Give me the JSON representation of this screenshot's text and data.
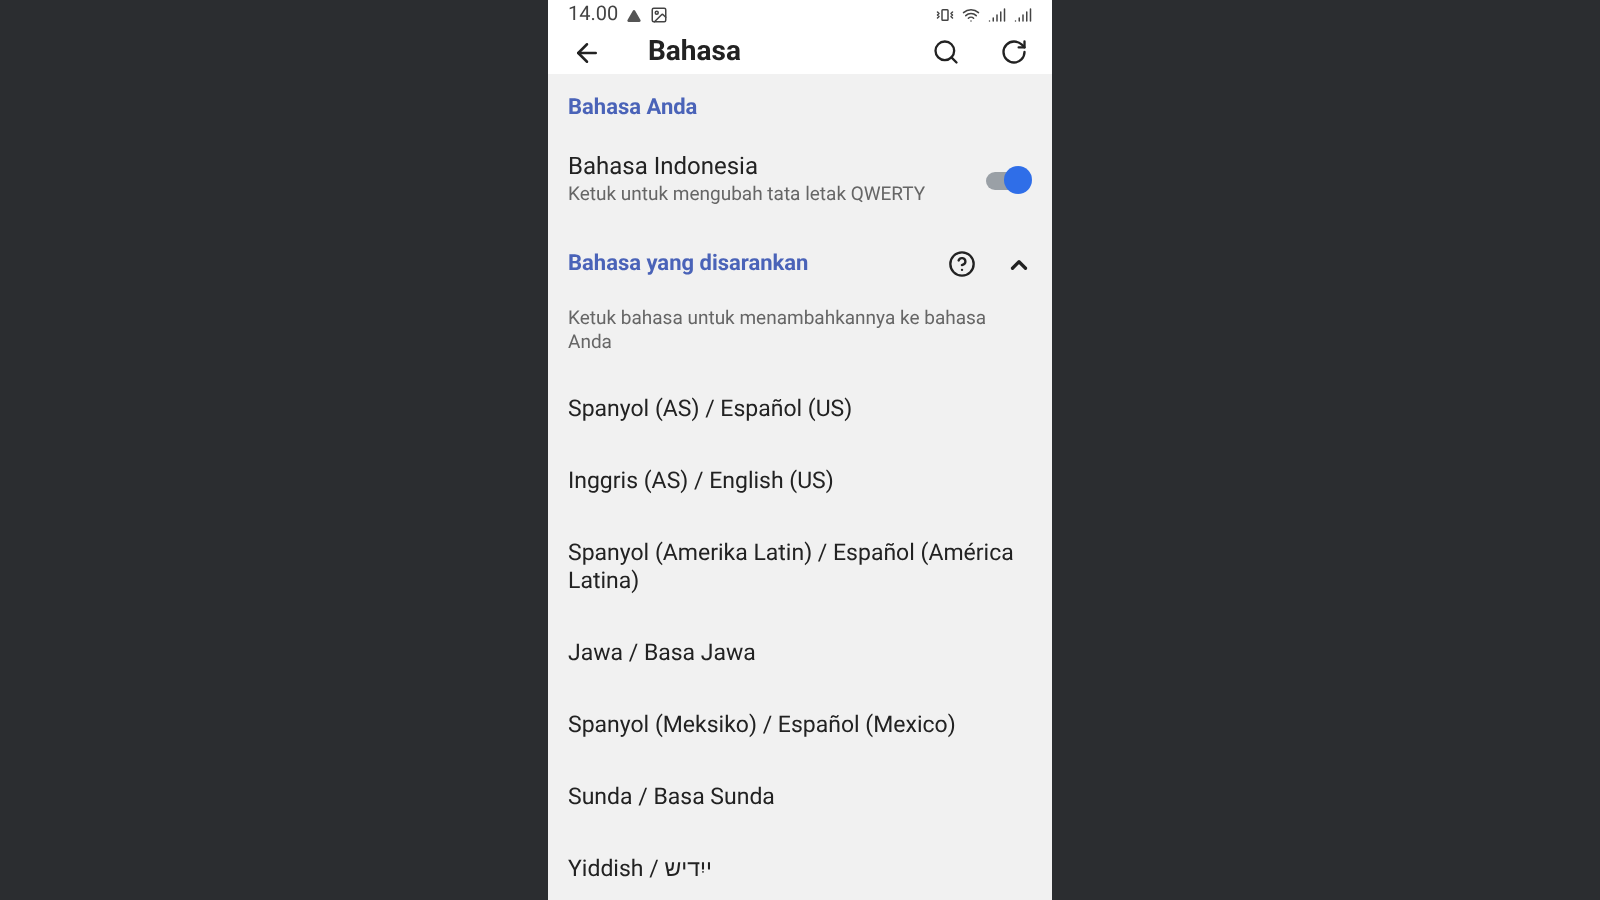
{
  "status_bar": {
    "time": "14.00"
  },
  "app_bar": {
    "title": "Bahasa"
  },
  "your_languages": {
    "heading": "Bahasa Anda",
    "items": [
      {
        "name": "Bahasa Indonesia",
        "subtitle": "Ketuk untuk mengubah tata letak QWERTY",
        "on": true
      }
    ]
  },
  "suggested": {
    "heading": "Bahasa yang disarankan",
    "expanded": true,
    "hint": "Ketuk bahasa untuk menambahkannya ke bahasa Anda",
    "items": [
      "Spanyol (AS) / Español (US)",
      "Inggris (AS) / English (US)",
      "Spanyol (Amerika Latin) / Español (América Latina)",
      "Jawa / Basa Jawa",
      "Spanyol (Meksiko) / Español (Mexico)",
      "Sunda / Basa Sunda",
      "Yiddish / ייִדיש"
    ]
  }
}
